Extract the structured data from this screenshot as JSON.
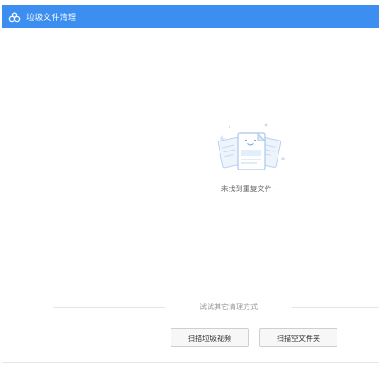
{
  "window": {
    "title": "垃圾文件清理",
    "title_icon": "cloud-icon",
    "accent_color": "#3c8ff0"
  },
  "main": {
    "empty_icon": "documents-icon",
    "empty_message": "未找到重复文件~"
  },
  "footer": {
    "divider_text": "试试其它清理方式",
    "buttons": {
      "scan_junk_videos": "扫描垃圾视频",
      "scan_empty_folders": "扫描空文件夹"
    }
  }
}
